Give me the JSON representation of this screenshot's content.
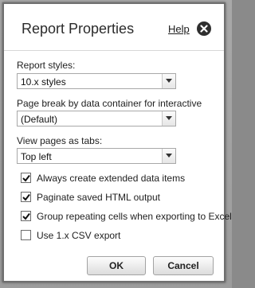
{
  "dialog": {
    "title": "Report Properties",
    "help_label": "Help"
  },
  "fields": [
    {
      "label": "Report styles:",
      "value": "10.x styles"
    },
    {
      "label": "Page break by data container for interactive HTML:",
      "value": "(Default)"
    },
    {
      "label": "View pages as tabs:",
      "value": "Top left"
    }
  ],
  "checkboxes": [
    {
      "label": "Always create extended data items",
      "checked": true
    },
    {
      "label": "Paginate saved HTML output",
      "checked": true
    },
    {
      "label": "Group repeating cells when exporting to Excel",
      "checked": true
    },
    {
      "label": "Use 1.x CSV export",
      "checked": false
    }
  ],
  "buttons": {
    "ok": "OK",
    "cancel": "Cancel"
  },
  "icons": {
    "close": "close-icon",
    "dropdown": "chevron-down-icon",
    "check": "check-icon"
  }
}
